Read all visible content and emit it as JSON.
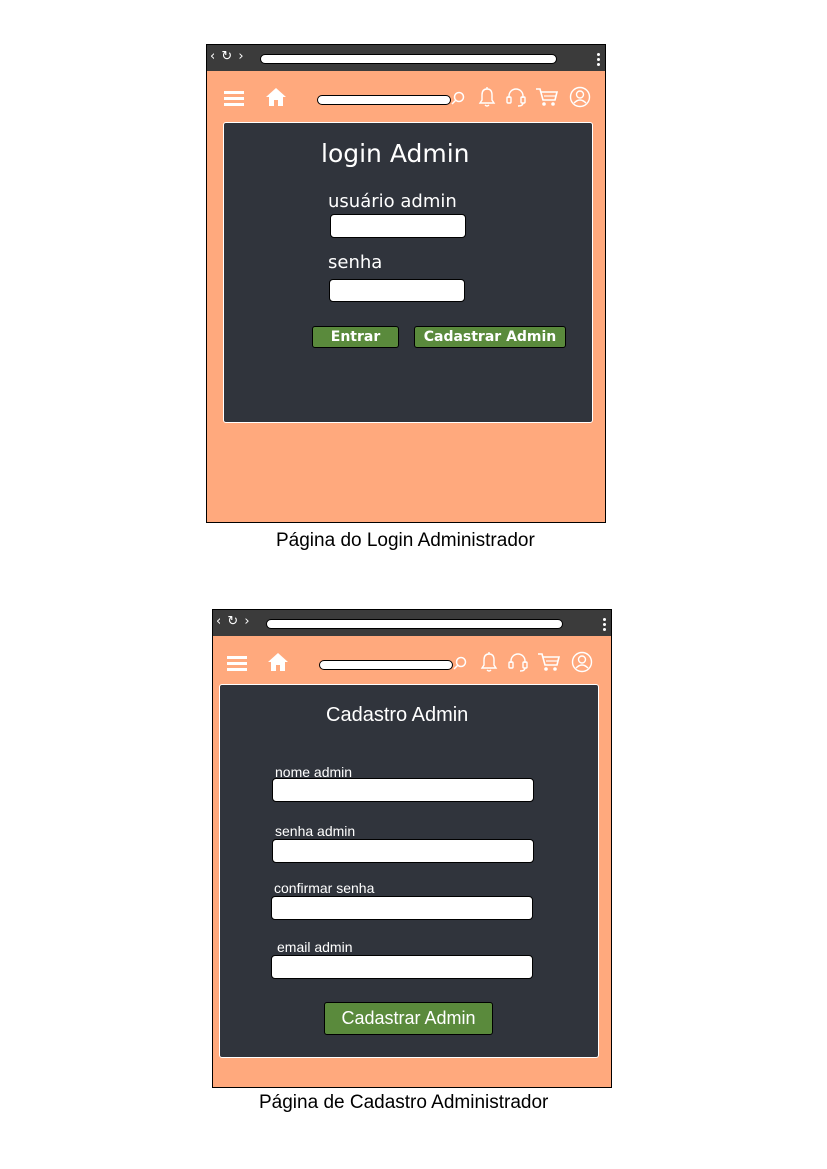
{
  "login": {
    "title": "login Admin",
    "user_label": "usuário admin",
    "password_label": "senha",
    "enter_button": "Entrar",
    "register_button": "Cadastrar Admin"
  },
  "login_caption": "Página do Login Administrador",
  "register": {
    "title": "Cadastro Admin",
    "name_label": "nome admin",
    "password_label": "senha admin",
    "confirm_label": "confirmar senha",
    "email_label": "email admin",
    "submit_button": "Cadastrar Admin"
  },
  "register_caption": "Página de Cadastro Administrador",
  "browser": {
    "nav_glyphs": "‹ ↻ ›",
    "icons": [
      "menu-icon",
      "home-icon",
      "search-icon",
      "bell-icon",
      "headset-icon",
      "cart-icon",
      "user-icon"
    ]
  },
  "colors": {
    "page_bg": "#FFA97D",
    "panel_bg": "#30343C",
    "button_green": "#5A8A3C",
    "browser_bar": "#3B3B3B"
  }
}
